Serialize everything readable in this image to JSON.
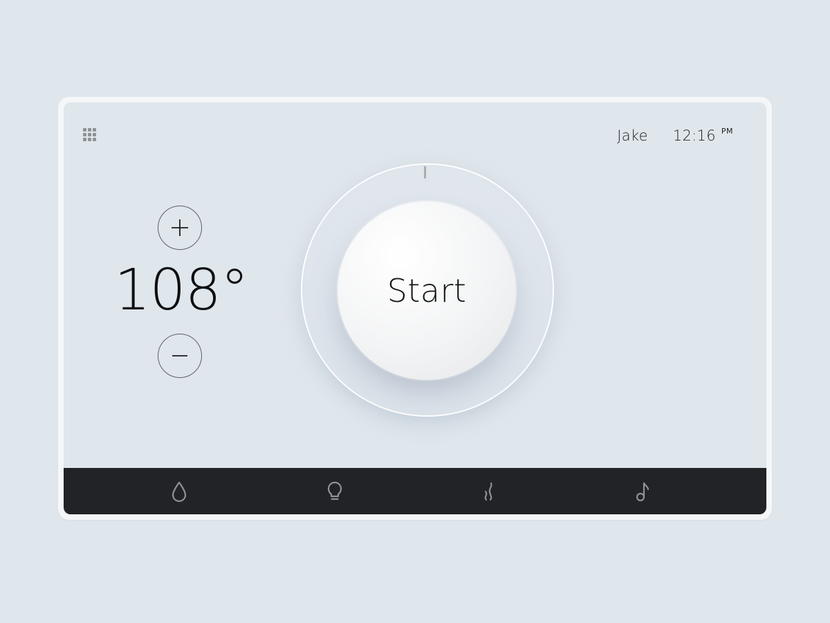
{
  "header": {
    "user_name": "Jake",
    "clock_time": "12:16",
    "clock_ampm": "PM"
  },
  "temperature": {
    "value": "108°",
    "increase_icon": "plus-icon",
    "decrease_icon": "minus-icon"
  },
  "dial": {
    "start_label": "Start"
  },
  "bottom_nav": {
    "items": [
      {
        "icon": "water-drop-icon"
      },
      {
        "icon": "light-bulb-icon"
      },
      {
        "icon": "steam-icon"
      },
      {
        "icon": "music-note-icon"
      }
    ]
  },
  "colors": {
    "background": "#dfe6ec",
    "bar": "#212327",
    "icon_muted": "#8e9398"
  }
}
